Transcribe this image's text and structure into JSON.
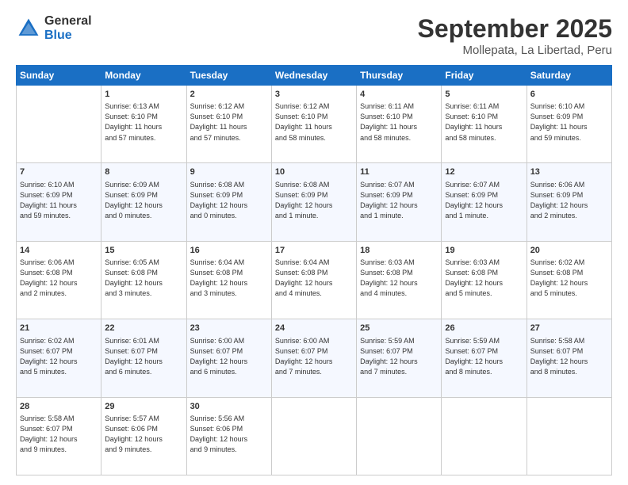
{
  "logo": {
    "general": "General",
    "blue": "Blue"
  },
  "title": "September 2025",
  "location": "Mollepata, La Libertad, Peru",
  "days_of_week": [
    "Sunday",
    "Monday",
    "Tuesday",
    "Wednesday",
    "Thursday",
    "Friday",
    "Saturday"
  ],
  "weeks": [
    [
      {
        "day": "",
        "content": ""
      },
      {
        "day": "1",
        "content": "Sunrise: 6:13 AM\nSunset: 6:10 PM\nDaylight: 11 hours\nand 57 minutes."
      },
      {
        "day": "2",
        "content": "Sunrise: 6:12 AM\nSunset: 6:10 PM\nDaylight: 11 hours\nand 57 minutes."
      },
      {
        "day": "3",
        "content": "Sunrise: 6:12 AM\nSunset: 6:10 PM\nDaylight: 11 hours\nand 58 minutes."
      },
      {
        "day": "4",
        "content": "Sunrise: 6:11 AM\nSunset: 6:10 PM\nDaylight: 11 hours\nand 58 minutes."
      },
      {
        "day": "5",
        "content": "Sunrise: 6:11 AM\nSunset: 6:10 PM\nDaylight: 11 hours\nand 58 minutes."
      },
      {
        "day": "6",
        "content": "Sunrise: 6:10 AM\nSunset: 6:09 PM\nDaylight: 11 hours\nand 59 minutes."
      }
    ],
    [
      {
        "day": "7",
        "content": "Sunrise: 6:10 AM\nSunset: 6:09 PM\nDaylight: 11 hours\nand 59 minutes."
      },
      {
        "day": "8",
        "content": "Sunrise: 6:09 AM\nSunset: 6:09 PM\nDaylight: 12 hours\nand 0 minutes."
      },
      {
        "day": "9",
        "content": "Sunrise: 6:08 AM\nSunset: 6:09 PM\nDaylight: 12 hours\nand 0 minutes."
      },
      {
        "day": "10",
        "content": "Sunrise: 6:08 AM\nSunset: 6:09 PM\nDaylight: 12 hours\nand 1 minute."
      },
      {
        "day": "11",
        "content": "Sunrise: 6:07 AM\nSunset: 6:09 PM\nDaylight: 12 hours\nand 1 minute."
      },
      {
        "day": "12",
        "content": "Sunrise: 6:07 AM\nSunset: 6:09 PM\nDaylight: 12 hours\nand 1 minute."
      },
      {
        "day": "13",
        "content": "Sunrise: 6:06 AM\nSunset: 6:09 PM\nDaylight: 12 hours\nand 2 minutes."
      }
    ],
    [
      {
        "day": "14",
        "content": "Sunrise: 6:06 AM\nSunset: 6:08 PM\nDaylight: 12 hours\nand 2 minutes."
      },
      {
        "day": "15",
        "content": "Sunrise: 6:05 AM\nSunset: 6:08 PM\nDaylight: 12 hours\nand 3 minutes."
      },
      {
        "day": "16",
        "content": "Sunrise: 6:04 AM\nSunset: 6:08 PM\nDaylight: 12 hours\nand 3 minutes."
      },
      {
        "day": "17",
        "content": "Sunrise: 6:04 AM\nSunset: 6:08 PM\nDaylight: 12 hours\nand 4 minutes."
      },
      {
        "day": "18",
        "content": "Sunrise: 6:03 AM\nSunset: 6:08 PM\nDaylight: 12 hours\nand 4 minutes."
      },
      {
        "day": "19",
        "content": "Sunrise: 6:03 AM\nSunset: 6:08 PM\nDaylight: 12 hours\nand 5 minutes."
      },
      {
        "day": "20",
        "content": "Sunrise: 6:02 AM\nSunset: 6:08 PM\nDaylight: 12 hours\nand 5 minutes."
      }
    ],
    [
      {
        "day": "21",
        "content": "Sunrise: 6:02 AM\nSunset: 6:07 PM\nDaylight: 12 hours\nand 5 minutes."
      },
      {
        "day": "22",
        "content": "Sunrise: 6:01 AM\nSunset: 6:07 PM\nDaylight: 12 hours\nand 6 minutes."
      },
      {
        "day": "23",
        "content": "Sunrise: 6:00 AM\nSunset: 6:07 PM\nDaylight: 12 hours\nand 6 minutes."
      },
      {
        "day": "24",
        "content": "Sunrise: 6:00 AM\nSunset: 6:07 PM\nDaylight: 12 hours\nand 7 minutes."
      },
      {
        "day": "25",
        "content": "Sunrise: 5:59 AM\nSunset: 6:07 PM\nDaylight: 12 hours\nand 7 minutes."
      },
      {
        "day": "26",
        "content": "Sunrise: 5:59 AM\nSunset: 6:07 PM\nDaylight: 12 hours\nand 8 minutes."
      },
      {
        "day": "27",
        "content": "Sunrise: 5:58 AM\nSunset: 6:07 PM\nDaylight: 12 hours\nand 8 minutes."
      }
    ],
    [
      {
        "day": "28",
        "content": "Sunrise: 5:58 AM\nSunset: 6:07 PM\nDaylight: 12 hours\nand 9 minutes."
      },
      {
        "day": "29",
        "content": "Sunrise: 5:57 AM\nSunset: 6:06 PM\nDaylight: 12 hours\nand 9 minutes."
      },
      {
        "day": "30",
        "content": "Sunrise: 5:56 AM\nSunset: 6:06 PM\nDaylight: 12 hours\nand 9 minutes."
      },
      {
        "day": "",
        "content": ""
      },
      {
        "day": "",
        "content": ""
      },
      {
        "day": "",
        "content": ""
      },
      {
        "day": "",
        "content": ""
      }
    ]
  ]
}
